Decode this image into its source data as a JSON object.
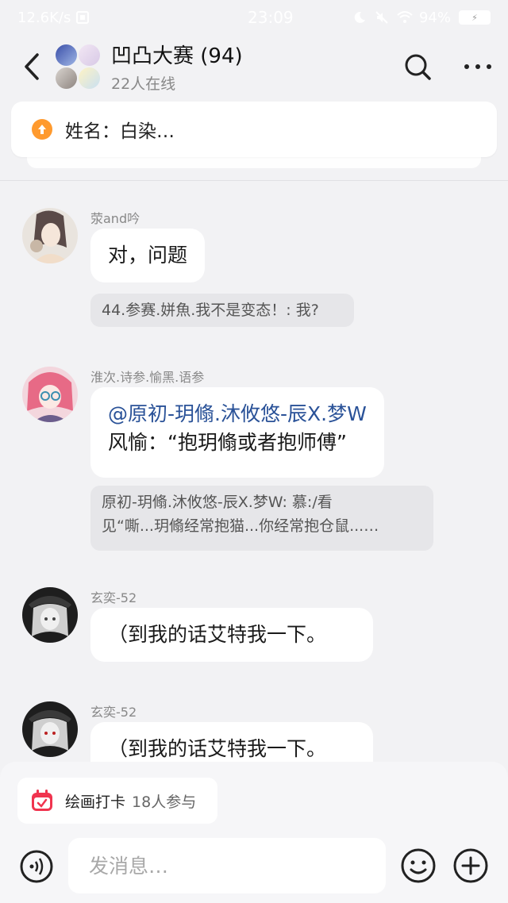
{
  "status_bar": {
    "speed": "12.6K/s",
    "time": "23:09",
    "battery": "94%"
  },
  "header": {
    "title": "凹凸大赛 (94)",
    "subtitle": "22人在线"
  },
  "pinned": {
    "text": "姓名：白染…"
  },
  "messages": [
    {
      "sender": "荥and吟",
      "text": "对，问题",
      "quote": "44.参赛.姘魚.我不是变态！: 我?"
    },
    {
      "sender": "淮次.诗参.愉黑.语参",
      "mention": "@原初-玥翛.沐攸悠-辰X.梦W",
      "text": "风愉：“抱玥翛或者抱师傅”",
      "quote_line1": "原初-玥翛.沐攸悠-辰X.梦W: 慕:/看",
      "quote_line2": "见“嘶...玥翛经常抱猫...你经常抱仓鼠...…"
    },
    {
      "sender": "玄奕-52",
      "text": "（到我的话艾特我一下。"
    },
    {
      "sender": "玄奕-52",
      "text": "（到我的话艾特我一下。"
    }
  ],
  "bottom": {
    "checkin_label": "绘画打卡",
    "checkin_count": "18人参与",
    "input_placeholder": "发消息…"
  },
  "colors": {
    "accent_orange": "#ff9a2e",
    "calendar_red": "#f0344f",
    "mention_blue": "#2a5298"
  }
}
